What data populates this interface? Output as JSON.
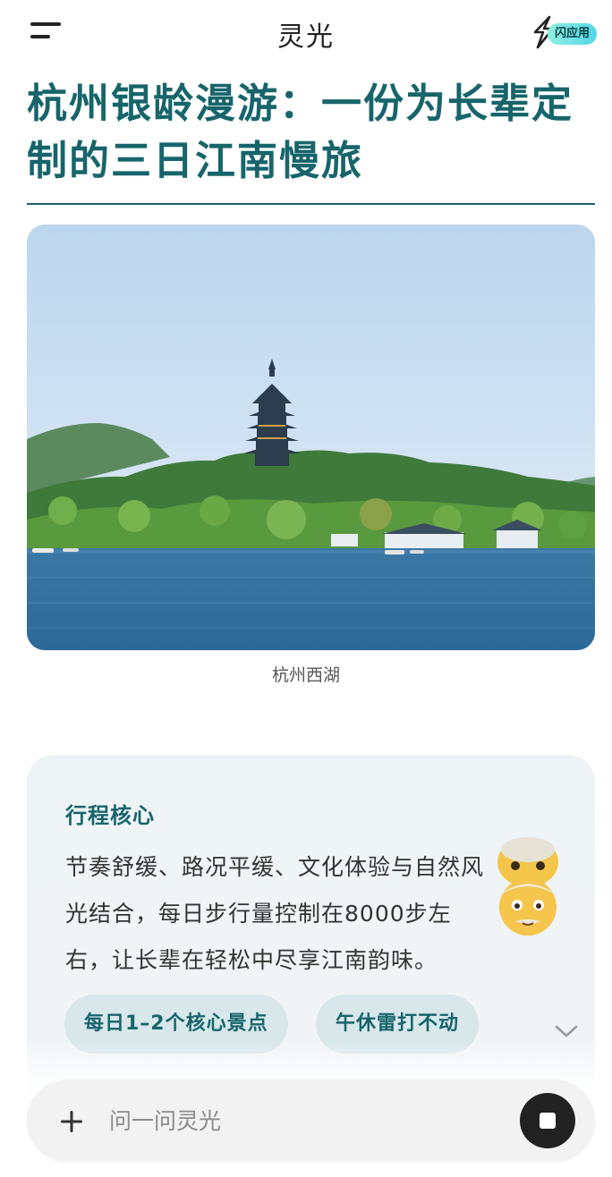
{
  "header": {
    "app_title": "灵光",
    "flash_app_label": "闪应用"
  },
  "article": {
    "title": "杭州银龄漫游：一份为长辈定制的三日江南慢旅",
    "hero_caption": "杭州西湖"
  },
  "core_card": {
    "heading": "行程核心",
    "body": "节奏舒缓、路况平缓、文化体验与自然风光结合，每日步行量控制在8000步左右，让长辈在轻松中尽享江南韵味。",
    "emoji_icon": "old-man-emoji",
    "chips": [
      "每日1–2个核心景点",
      "午休雷打不动"
    ]
  },
  "composer": {
    "placeholder": "问一问灵光"
  },
  "colors": {
    "accent": "#17656b",
    "chip_bg": "#d8e7ea",
    "badge_gradient": [
      "#8ff0e0",
      "#52d6e6"
    ]
  }
}
